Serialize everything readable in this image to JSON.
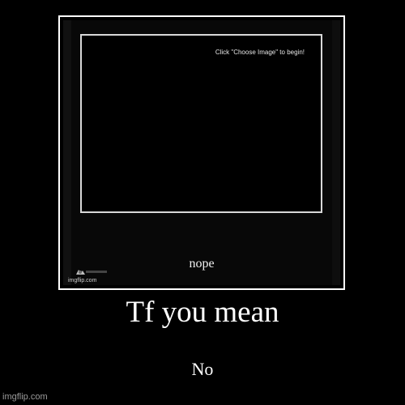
{
  "poster": {
    "title": "Tf you mean",
    "subtitle": "No",
    "watermark": "imgflip.com"
  },
  "embedded_image": {
    "hint_text": "Click \"Choose Image\" to begin!",
    "caption": "nope",
    "watermark": "imgflip.com",
    "watermark_icon": "imgflip-logo-icon"
  },
  "colors": {
    "background": "#000000",
    "frame_border": "#ffffff",
    "text": "#ffffff",
    "watermark": "#9a9a9a"
  }
}
